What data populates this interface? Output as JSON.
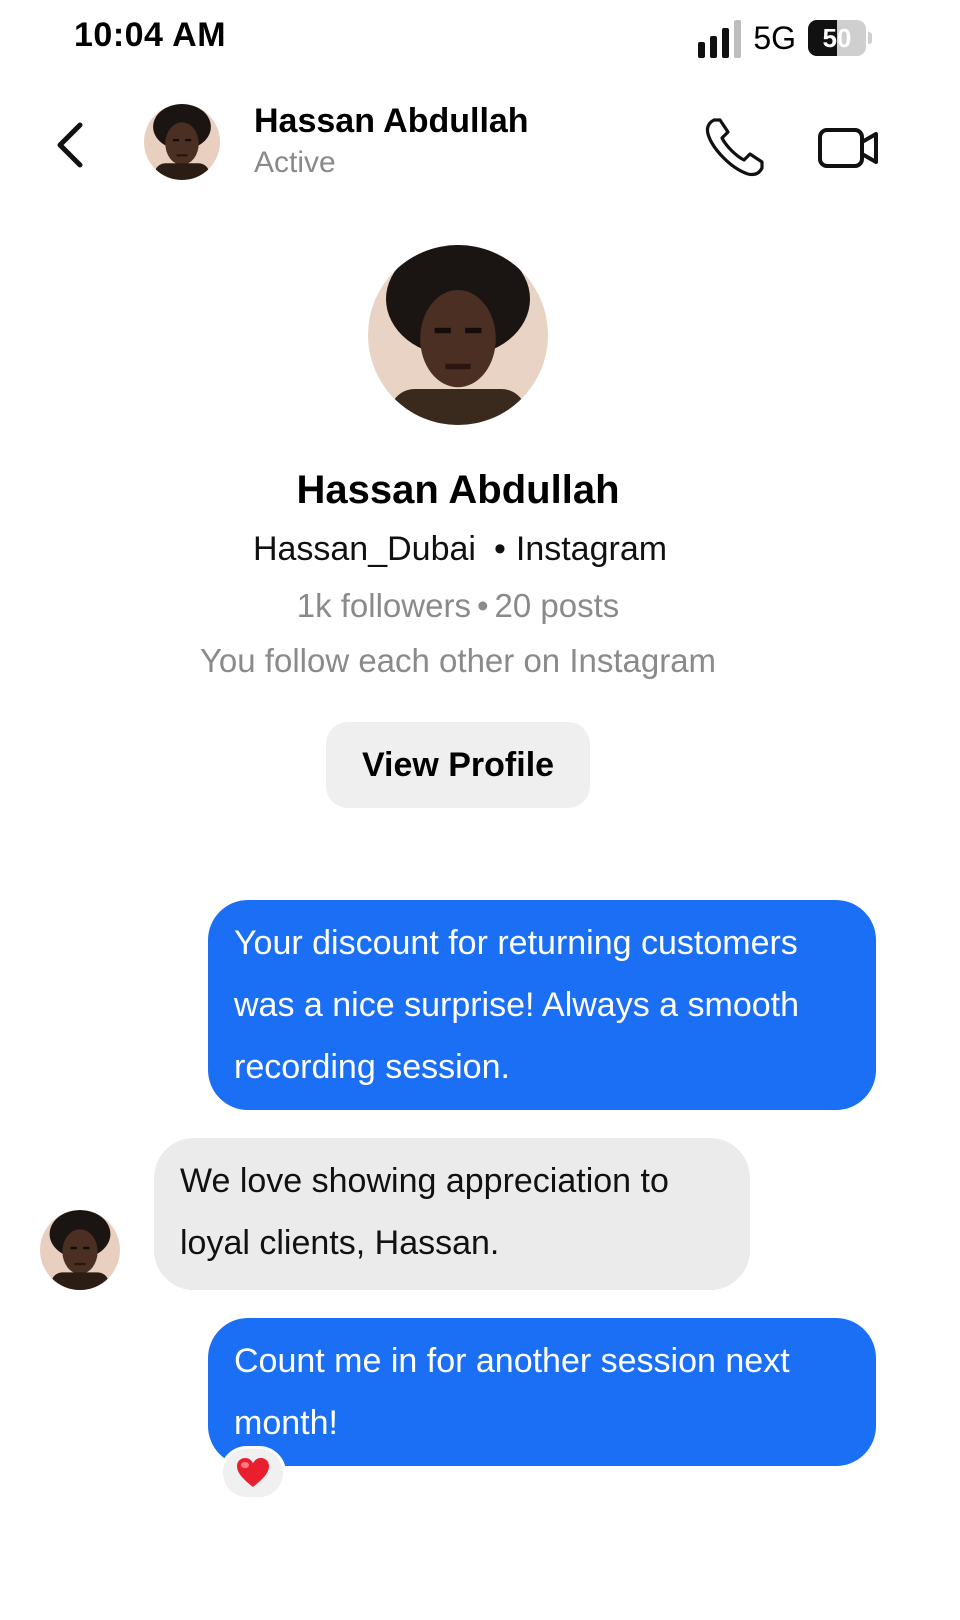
{
  "status_bar": {
    "time": "10:04 AM",
    "network": "5G",
    "battery_percent": "50",
    "battery_level": 0.5,
    "signal_bars": 3
  },
  "header": {
    "back_icon": "chevron-left-icon",
    "name": "Hassan Abdullah",
    "status": "Active",
    "call_icon": "phone-icon",
    "video_icon": "video-camera-icon"
  },
  "profile": {
    "name": "Hassan Abdullah",
    "handle": "Hassan_Dubai",
    "separator": "•",
    "platform": "Instagram",
    "followers": "1k followers",
    "posts": "20 posts",
    "mutual": "You follow each other on Instagram",
    "view_profile_label": "View Profile"
  },
  "messages": [
    {
      "direction": "sent",
      "text": "Your discount for returning customers was a nice surprise! Always a smooth recording session."
    },
    {
      "direction": "received",
      "text": "We love showing appreciation to loyal clients, Hassan."
    },
    {
      "direction": "sent",
      "text": "Count me in for another session next month!",
      "reaction": "❤️"
    }
  ],
  "colors": {
    "sent_bubble": "#1a6ff5",
    "received_bubble": "#ebebeb",
    "muted_text": "#8a8a8a",
    "button_bg": "#efefef"
  }
}
